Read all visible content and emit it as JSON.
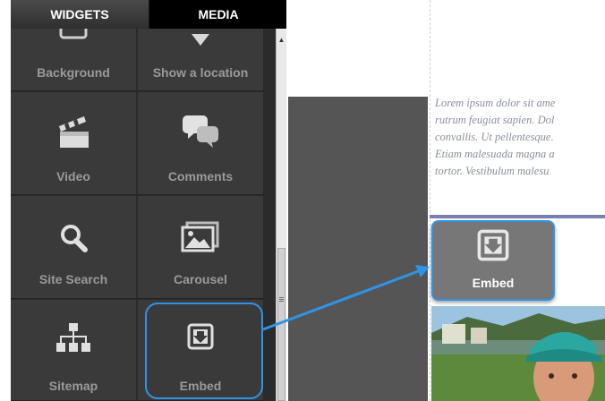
{
  "tabs": [
    {
      "label": "WIDGETS"
    },
    {
      "label": "MEDIA"
    }
  ],
  "widgets": [
    {
      "label": "Background",
      "icon": "background-icon"
    },
    {
      "label": "Show a location",
      "icon": "map-pin-icon"
    },
    {
      "label": "Video",
      "icon": "clapperboard-icon"
    },
    {
      "label": "Comments",
      "icon": "speech-bubbles-icon"
    },
    {
      "label": "Site Search",
      "icon": "magnifier-icon"
    },
    {
      "label": "Carousel",
      "icon": "image-gallery-icon"
    },
    {
      "label": "Sitemap",
      "icon": "sitemap-icon"
    },
    {
      "label": "Embed",
      "icon": "embed-download-icon"
    }
  ],
  "lorem_lines": [
    "Lorem ipsum dolor sit ame",
    "rutrum feugiat sapien. Dol",
    "convallis. Ut pellentesque.",
    "Etiam malesuada magna a",
    "tortor. Vestibulum malesu"
  ],
  "dragged_widget": {
    "label": "Embed",
    "icon": "embed-download-icon"
  },
  "colors": {
    "highlight": "#2e95e6",
    "panel": "#2b2b2b",
    "accent_line": "#7a7eb5"
  }
}
